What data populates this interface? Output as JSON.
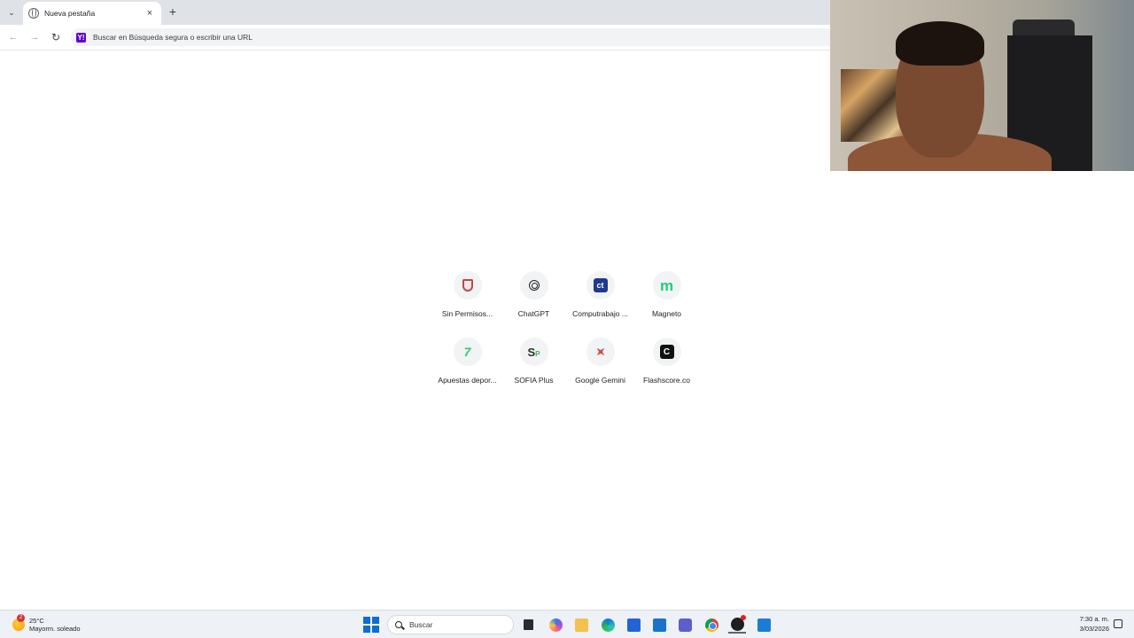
{
  "browser": {
    "tab_title": "Nueva pestaña",
    "tab_list_icon": "chevron-down-icon",
    "close_tab_glyph": "×",
    "new_tab_glyph": "+",
    "omnibox_placeholder": "Buscar en Búsqueda segura o escribir una URL",
    "omnibox_icon": "Y!"
  },
  "shortcuts": [
    {
      "label": "Sin Permisos...",
      "icon": "shield-icon"
    },
    {
      "label": "ChatGPT",
      "icon": "chatgpt-icon"
    },
    {
      "label": "Computrabajo ...",
      "icon": "computrabajo-icon",
      "glyph": "ct"
    },
    {
      "label": "Magneto",
      "icon": "magneto-icon",
      "glyph": "m"
    },
    {
      "label": "Apuestas depor...",
      "icon": "betting-icon",
      "glyph": "7"
    },
    {
      "label": "SOFIA Plus",
      "icon": "sofia-plus-icon",
      "glyph": "S",
      "glyph_sub": "P"
    },
    {
      "label": "Google Gemini",
      "icon": "gemini-icon"
    },
    {
      "label": "Flashscore.co",
      "icon": "flashscore-icon",
      "glyph": "C"
    }
  ],
  "taskbar": {
    "weather_temp": "25°C",
    "weather_desc": "Mayorm. soleado",
    "weather_badge": "2",
    "search_placeholder": "Buscar",
    "clock_time": "7:30 a. m.",
    "clock_date": "3/03/2026"
  },
  "colors": {
    "tabstrip": "#dfe3e8",
    "taskbar": "#eef1f6",
    "accent": "#0f6cd1"
  }
}
